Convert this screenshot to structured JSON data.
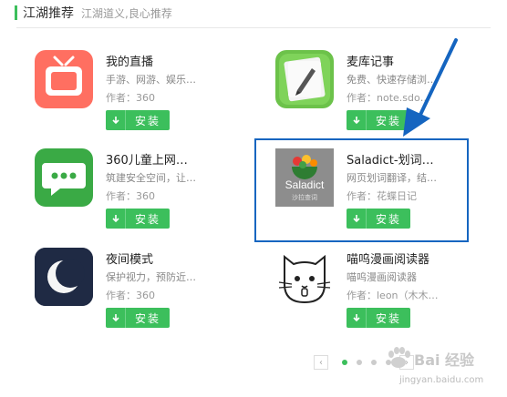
{
  "section": {
    "title": "江湖推荐",
    "subtitle": "江湖道义,良心推荐",
    "accent": "#3cbf5c"
  },
  "apps": [
    {
      "name": "我的直播",
      "desc": "手游、网游、娱乐…",
      "author": "作者：360",
      "install": "安装",
      "icon": "tv-icon",
      "icon_color": "#ff6f61"
    },
    {
      "name": "麦库记事",
      "desc": "免费、快速存储浏…",
      "author": "作者：note.sdo…",
      "install": "安装",
      "icon": "note-pencil-icon",
      "icon_color": "#6cc24a"
    },
    {
      "name": "360儿童上网…",
      "desc": "筑建安全空间，让…",
      "author": "作者：360",
      "install": "安装",
      "icon": "chat-bubble-icon",
      "icon_color": "#3aaa45"
    },
    {
      "name": "Saladict-划词…",
      "desc": "网页划词翻译，结…",
      "author": "作者：花蝶日记",
      "install": "安装",
      "icon": "saladict-icon",
      "icon_color": "#8a8a8a",
      "icon_label": "Saladict",
      "icon_sublabel": "沙拉查词"
    },
    {
      "name": "夜间模式",
      "desc": "保护视力，预防近…",
      "author": "作者：360",
      "install": "安装",
      "icon": "moon-icon",
      "icon_color": "#1f2a44"
    },
    {
      "name": "喵呜漫画阅读器",
      "desc": "喵呜漫画阅读器",
      "author": "作者：leon（木木…",
      "install": "安装",
      "icon": "cat-icon",
      "icon_color": "#ffffff"
    }
  ],
  "annotation": {
    "color": "#1565c0"
  },
  "pager": {
    "prev": "‹",
    "next": "›",
    "pages": 4,
    "active": 1
  },
  "watermark": {
    "text": "Bai 经验",
    "url": "jingyan.baidu.com"
  }
}
